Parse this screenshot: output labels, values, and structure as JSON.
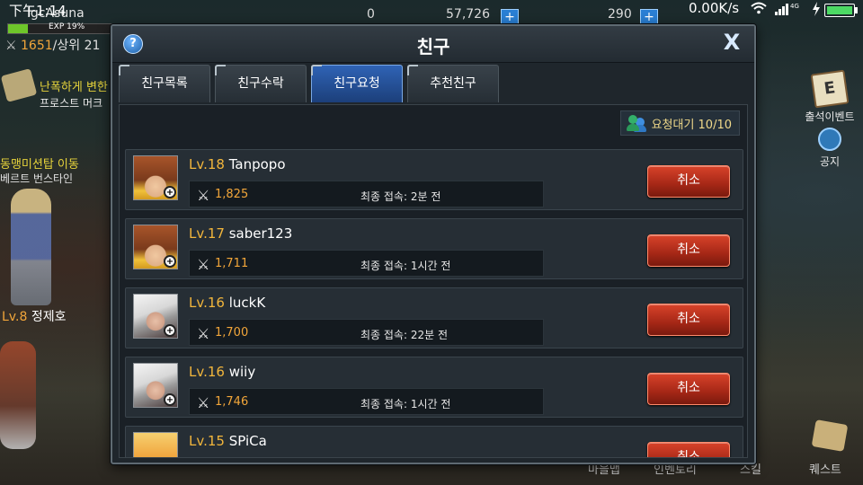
{
  "status_bar": {
    "time": "下午1:14",
    "network_speed": "0.00K/s",
    "icons": [
      "wifi-icon",
      "signal-4g-icon",
      "charging-icon",
      "battery-icon"
    ]
  },
  "hud": {
    "player_name": "lgcAsuna",
    "exp_label": "EXP 19%",
    "exp_percent": 19,
    "combat_power": "1651",
    "rank_text": "/상위 21",
    "resource_1": "0",
    "resource_2": "57,726",
    "resource_3": "290",
    "event_title": "난폭하게 변한",
    "event_sub": "프로스트 머크",
    "guild_title": "동맹미션탑 이동",
    "guild_sub": "베르트 번스타인",
    "npc_level": "Lv.8",
    "npc_name": "정제호",
    "right_buttons": [
      {
        "label": "출석이벤트",
        "icon": "calendar-scroll-icon"
      },
      {
        "label": "공지",
        "icon": "notice-icon"
      }
    ],
    "bottom_menu": [
      "마을맵",
      "인벤토리",
      "스킬",
      "퀘스트"
    ]
  },
  "dialog": {
    "title": "친구",
    "help_label": "?",
    "close_label": "X",
    "tabs": [
      {
        "label": "친구목록",
        "active": false
      },
      {
        "label": "친구수락",
        "active": false
      },
      {
        "label": "친구요청",
        "active": true
      },
      {
        "label": "추천친구",
        "active": false
      }
    ],
    "pending_label": "요청대기 10/10",
    "cancel_label": "취소",
    "rows": [
      {
        "level": "Lv.18",
        "name": "Tanpopo",
        "power": "1,825",
        "last_login": "최종 접속: 2분 전"
      },
      {
        "level": "Lv.17",
        "name": "saber123",
        "power": "1,711",
        "last_login": "최종 접속: 1시간 전"
      },
      {
        "level": "Lv.16",
        "name": "luckK",
        "power": "1,700",
        "last_login": "최종 접속: 22분 전"
      },
      {
        "level": "Lv.16",
        "name": "wiiy",
        "power": "1,746",
        "last_login": "최종 접속: 1시간 전"
      },
      {
        "level": "Lv.15",
        "name": "SPiCa",
        "power": "",
        "last_login": ""
      }
    ]
  },
  "colors": {
    "accent_tab": "#2f63b5",
    "cancel_button": "#b3301c",
    "level_text": "#f2b63c",
    "power_text": "#f2a63a"
  }
}
